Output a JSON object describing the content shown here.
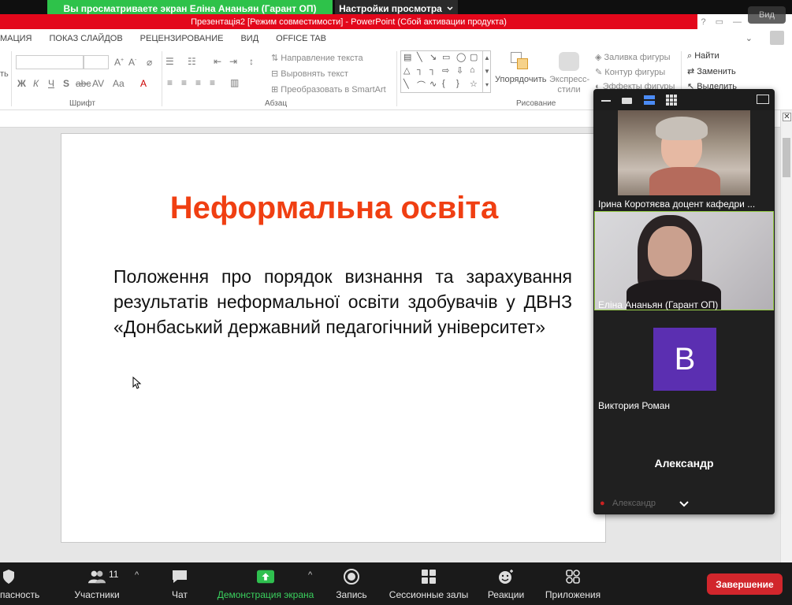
{
  "zoom_banner": {
    "sharing_text": "Вы просматриваете экран Еліна Ананьян (Гарант ОП)",
    "view_options": "Настройки просмотра",
    "view_button": "Вид"
  },
  "ppt": {
    "window_title": "Презентація2 [Режим совместимости] - PowerPoint (Сбой активации продукта)",
    "tabs": [
      "МАЦИЯ",
      "ПОКАЗ СЛАЙДОВ",
      "РЕЦЕНЗИРОВАНИЕ",
      "ВИД",
      "OFFICE TAB"
    ],
    "ribbon": {
      "left_cut": "ть",
      "group_font": "Шрифт",
      "group_paragraph": "Абзац",
      "group_drawing": "Рисование",
      "text_direction": "Направление текста",
      "align_text": "Выровнять текст",
      "smartart": "Преобразовать в SmartArt",
      "arrange": "Упорядочить",
      "quick_styles": "Экспресс-стили",
      "shape_fill": "Заливка фигуры",
      "shape_outline": "Контур фигуры",
      "shape_effects": "Эффекты фигуры",
      "find": "Найти",
      "replace": "Заменить",
      "select": "Выделить"
    },
    "slide": {
      "title": "Неформальна освіта",
      "body": "Положення про порядок визнання та зарахування результатів неформальної освіти здобувачів у ДВНЗ «Донбаський державний педагогічний університет»"
    }
  },
  "gallery": {
    "participants": [
      {
        "name": "Ірина Коротяєва доцент кафедри ..."
      },
      {
        "name": "Еліна Ананьян (Гарант ОП)"
      },
      {
        "name": "Виктория Роман",
        "initial": "В"
      },
      {
        "name": "Александр"
      }
    ],
    "footer_name": "Александр"
  },
  "toolbar": {
    "security": "пасность",
    "participants": "Участники",
    "participants_count": "11",
    "chat": "Чат",
    "share": "Демонстрация экрана",
    "record": "Запись",
    "breakout": "Сессионные залы",
    "reactions": "Реакции",
    "apps": "Приложения",
    "end": "Завершение"
  },
  "colors": {
    "share_green": "#2ec24a",
    "ppt_red": "#e3071b",
    "slide_title": "#f03f12",
    "end_red": "#d1262c",
    "avatar_purple": "#5b2fb1"
  }
}
